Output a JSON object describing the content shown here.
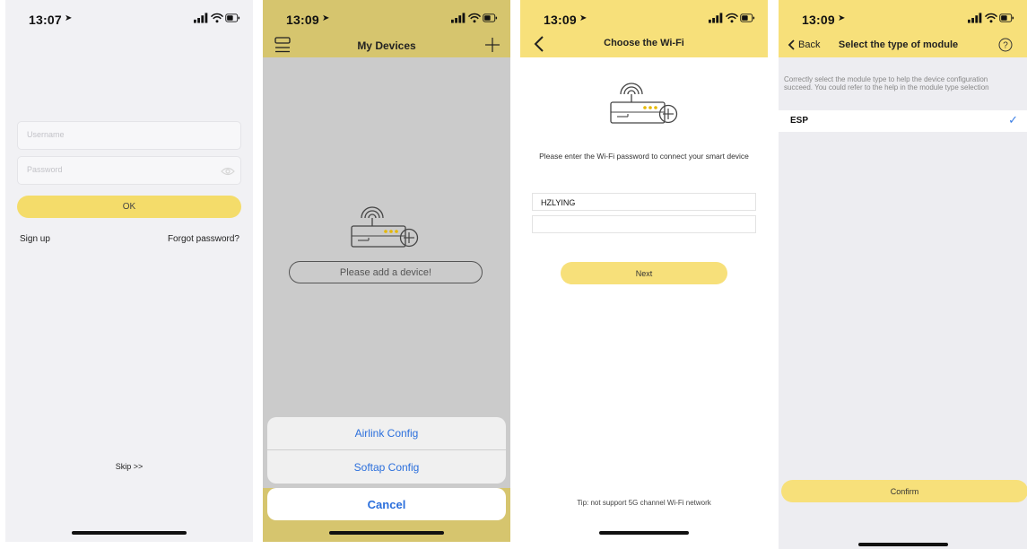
{
  "screen1": {
    "time": "13:07",
    "username_placeholder": "Username",
    "password_placeholder": "Password",
    "ok_label": "OK",
    "signup_label": "Sign up",
    "forgot_label": "Forgot password?",
    "skip_label": "Skip >>"
  },
  "screen2": {
    "time": "13:09",
    "title": "My Devices",
    "empty_prompt": "Please add a device!",
    "sheet_items": [
      "Airlink Config",
      "Softap Config"
    ],
    "cancel_label": "Cancel"
  },
  "screen3": {
    "time": "13:09",
    "title": "Choose the Wi-Fi",
    "prompt": "Please enter the Wi-Fi password to connect your smart device",
    "ssid_value": "HZLYING",
    "password_value": "",
    "next_label": "Next",
    "tip": "Tip: not support 5G channel Wi-Fi network"
  },
  "screen4": {
    "time": "13:09",
    "back_label": "Back",
    "title": "Select the type of module",
    "description": "Correctly select the module type to help the device configuration succeed. You could refer to the help in the module type selection",
    "module_option": "ESP",
    "confirm_label": "Confirm"
  },
  "icons": {
    "location": "location-arrow-icon",
    "signal": "cellular-signal-icon",
    "wifi": "wifi-icon",
    "battery": "battery-icon",
    "router": "router-add-icon",
    "eye": "eye-icon",
    "menu": "menu-icon",
    "plus": "plus-icon",
    "back": "chevron-left-icon",
    "help": "help-icon",
    "check": "checkmark-icon"
  },
  "colors": {
    "accent_yellow": "#f7e07a",
    "dim_yellow": "#d6c56e",
    "ios_blue": "#2b6fdc",
    "check_blue": "#3a7ee5"
  }
}
